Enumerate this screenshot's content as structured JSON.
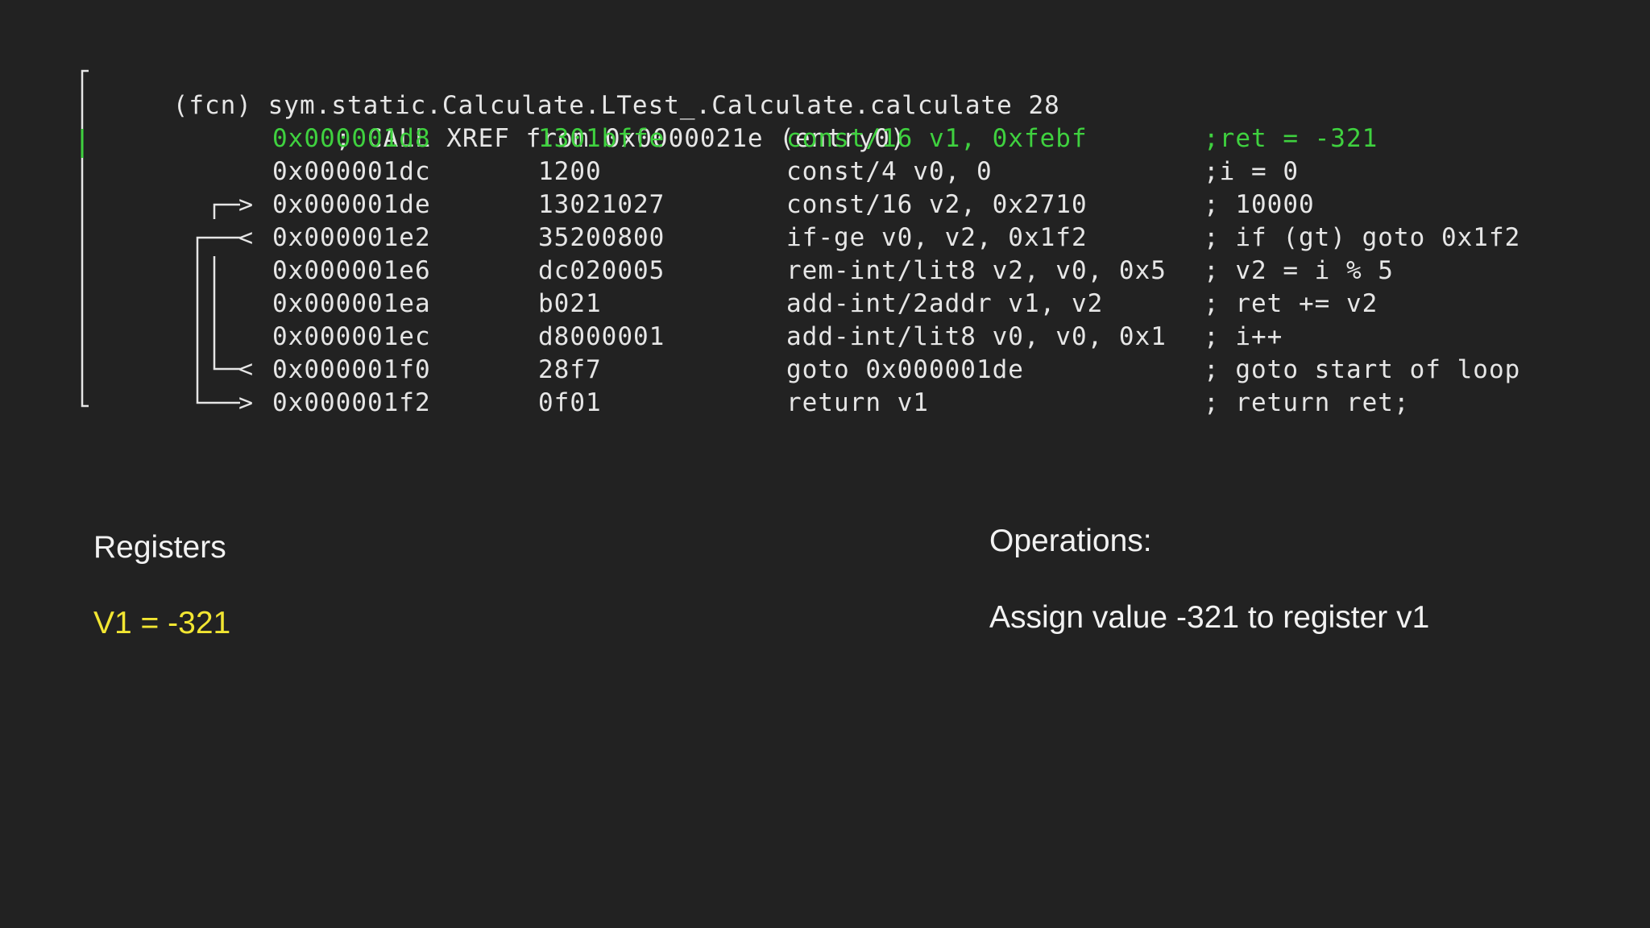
{
  "header": {
    "fcn_line": "(fcn) sym.static.Calculate.LTest_.Calculate.calculate 28",
    "xref_line": "; CALL XREF from 0x0000021e (entry0)"
  },
  "rows": [
    {
      "addr": "0x000001d8",
      "bytes": "1301bffe",
      "instr": "const/16 v1, 0xfebf",
      "comment": ";ret = -321",
      "highlight": true
    },
    {
      "addr": "0x000001dc",
      "bytes": "1200",
      "instr": "const/4 v0, 0",
      "comment": ";i = 0",
      "highlight": false
    },
    {
      "addr": "0x000001de",
      "bytes": "13021027",
      "instr": "const/16 v2, 0x2710",
      "comment": "; 10000",
      "highlight": false
    },
    {
      "addr": "0x000001e2",
      "bytes": "35200800",
      "instr": "if-ge v0, v2, 0x1f2",
      "comment": "; if (gt) goto 0x1f2",
      "highlight": false
    },
    {
      "addr": "0x000001e6",
      "bytes": "dc020005",
      "instr": "rem-int/lit8 v2, v0, 0x5",
      "comment": "; v2 = i % 5",
      "highlight": false
    },
    {
      "addr": "0x000001ea",
      "bytes": "b021",
      "instr": "add-int/2addr v1, v2",
      "comment": "; ret += v2",
      "highlight": false
    },
    {
      "addr": "0x000001ec",
      "bytes": "d8000001",
      "instr": "add-int/lit8 v0, v0, 0x1",
      "comment": "; i++",
      "highlight": false
    },
    {
      "addr": "0x000001f0",
      "bytes": "28f7",
      "instr": "goto 0x000001de",
      "comment": "; goto start of loop",
      "highlight": false
    },
    {
      "addr": "0x000001f2",
      "bytes": "0f01",
      "instr": "return v1",
      "comment": "; return ret;",
      "highlight": false
    }
  ],
  "flow_markers": {
    "arrow_in": ">",
    "arrow_out": "<"
  },
  "registers": {
    "title": "Registers",
    "value": "V1 = -321"
  },
  "operations": {
    "title": "Operations:",
    "text": "Assign value -321 to register v1"
  },
  "colors": {
    "background": "#222222",
    "text": "#e6e6e6",
    "highlight": "#3fd13f",
    "register_value": "#f2e632"
  }
}
